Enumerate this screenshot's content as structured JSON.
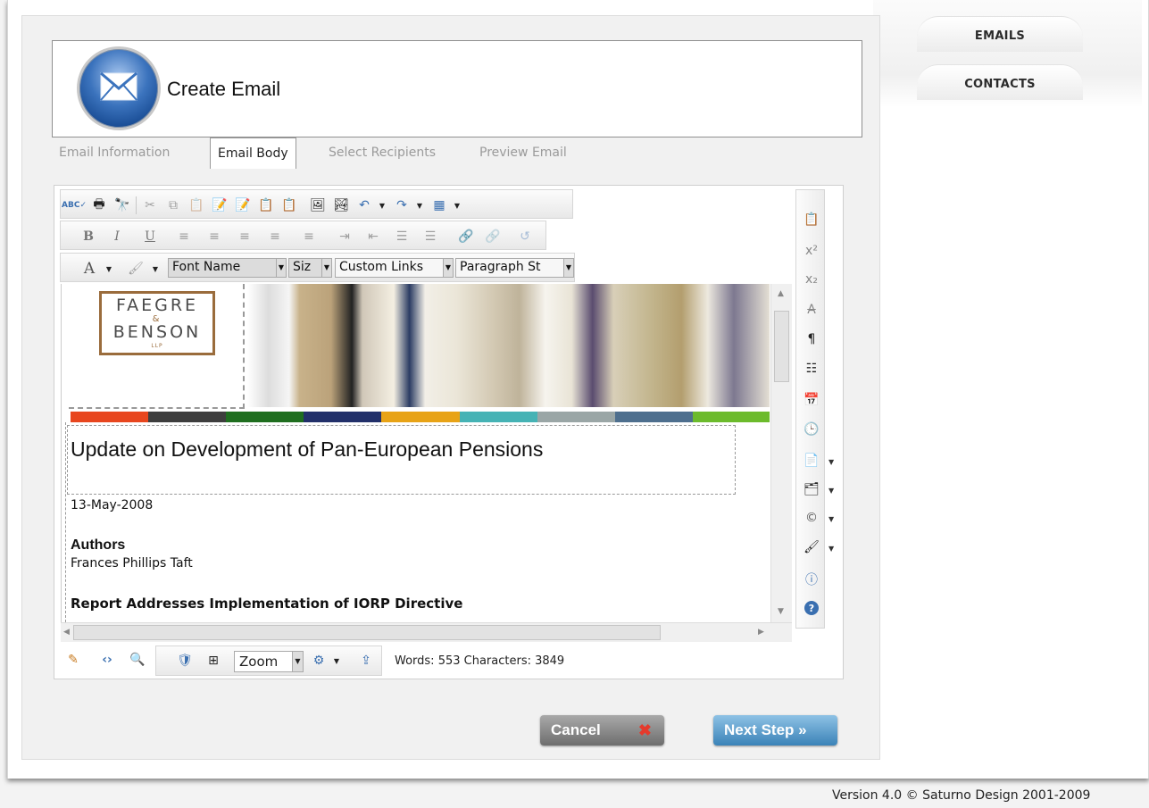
{
  "nav": {
    "emails_label": "EMAILS",
    "contacts_label": "CONTACTS"
  },
  "header": {
    "title": "Create Email"
  },
  "steps": [
    {
      "label": "Email Information"
    },
    {
      "label": "Email Body"
    },
    {
      "label": "Select Recipients"
    },
    {
      "label": "Preview Email"
    }
  ],
  "toolbar": {
    "font_name": "Font Name",
    "font_size": "Siz",
    "custom_links": "Custom Links",
    "paragraph_style": "Paragraph St",
    "bold": "B",
    "italic": "I",
    "underline": "U",
    "font_color": "A"
  },
  "document": {
    "logo_line1": "FAEGRE",
    "logo_amp": "&",
    "logo_line2": "BENSON",
    "logo_sub": "LLP",
    "title": "Update on Development of Pan-European Pensions",
    "date": "13-May-2008",
    "authors_label": "Authors",
    "author": "Frances Phillips Taft",
    "report_title": "Report Addresses Implementation of IORP Directive",
    "stripe_colors": [
      "#e8461e",
      "#3e3e3e",
      "#1f6e1f",
      "#22306a",
      "#e8a316",
      "#46b3b5",
      "#9aa6a6",
      "#4e6f8e",
      "#6cbb2c"
    ]
  },
  "status_bar": {
    "zoom_label": "Zoom",
    "word_count": "Words: 553 Characters: 3849"
  },
  "actions": {
    "cancel_label": "Cancel",
    "next_label": "Next Step »"
  },
  "footer": {
    "version": "Version 4.0 © Saturno Design 2001-2009"
  },
  "colors": {
    "next_button": "#4a90c4",
    "cancel_button": "#8a8a8a",
    "cancel_x": "#e53a2c"
  }
}
